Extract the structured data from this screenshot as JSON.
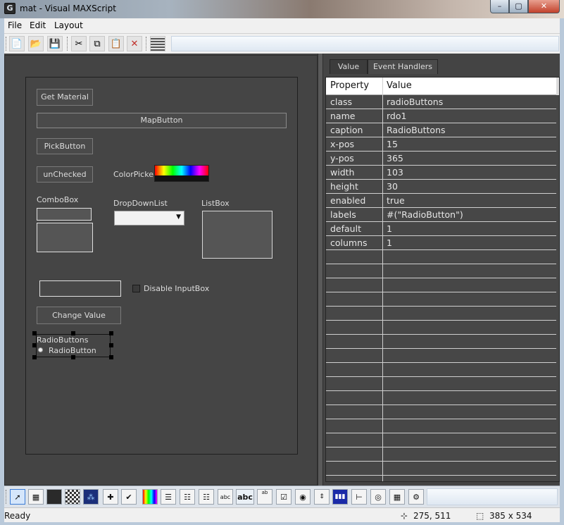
{
  "window": {
    "title": "mat - Visual MAXScript",
    "app_icon_letter": "G",
    "controls": {
      "minimize_glyph": "–",
      "maximize_glyph": "▢",
      "close_glyph": "✕"
    }
  },
  "menu": [
    "File",
    "Edit",
    "Layout"
  ],
  "toolbar": {
    "icons": [
      "new-file-icon",
      "open-folder-icon",
      "save-icon",
      "cut-icon",
      "copy-icon",
      "paste-icon",
      "delete-icon",
      "grid-icon"
    ]
  },
  "form": {
    "get_material": "Get Material",
    "map_button": "MapButton",
    "pick_button": "PickButton",
    "unchecked": "unChecked",
    "color_picker": "ColorPicker",
    "combobox": "ComboBox",
    "dropdownlist": "DropDownList",
    "listbox": "ListBox",
    "disable_inputbox": "Disable InputBox",
    "change_value": "Change Value",
    "radio_group": "RadioButtons",
    "radio_item": "RadioButton"
  },
  "tabs": [
    "Value",
    "Event Handlers"
  ],
  "properties": {
    "header": {
      "property": "Property",
      "value": "Value"
    },
    "rows": [
      {
        "name": "class",
        "value": "radioButtons"
      },
      {
        "name": "name",
        "value": "rdo1"
      },
      {
        "name": "caption",
        "value": "RadioButtons"
      },
      {
        "name": "x-pos",
        "value": "15"
      },
      {
        "name": "y-pos",
        "value": "365"
      },
      {
        "name": "width",
        "value": "103"
      },
      {
        "name": "height",
        "value": "30"
      },
      {
        "name": "enabled",
        "value": "true"
      },
      {
        "name": "labels",
        "value": "#(\"RadioButton\")"
      },
      {
        "name": "default",
        "value": "1"
      },
      {
        "name": "columns",
        "value": "1"
      }
    ]
  },
  "bottom_toolbar": {
    "icons": [
      "pointer-icon",
      "bitmap-icon",
      "groupbox-icon",
      "checker-icon",
      "image-icon",
      "plus-icon",
      "checkmark-icon",
      "color-icon",
      "list-icon",
      "combo-icon",
      "listbox-icon",
      "edittext-icon",
      "label-icon",
      "editbox-icon",
      "checkbox-icon",
      "radio-icon",
      "spinner-icon",
      "progress-icon",
      "slider-icon",
      "timer-icon",
      "dotnet-icon",
      "activex-icon"
    ],
    "labels": {
      "abc_small": "abc",
      "abc_bold": "abc",
      "ab": "ab"
    }
  },
  "status": {
    "text": "Ready",
    "cursor_pos": "275, 511",
    "size": "385 x 534"
  }
}
